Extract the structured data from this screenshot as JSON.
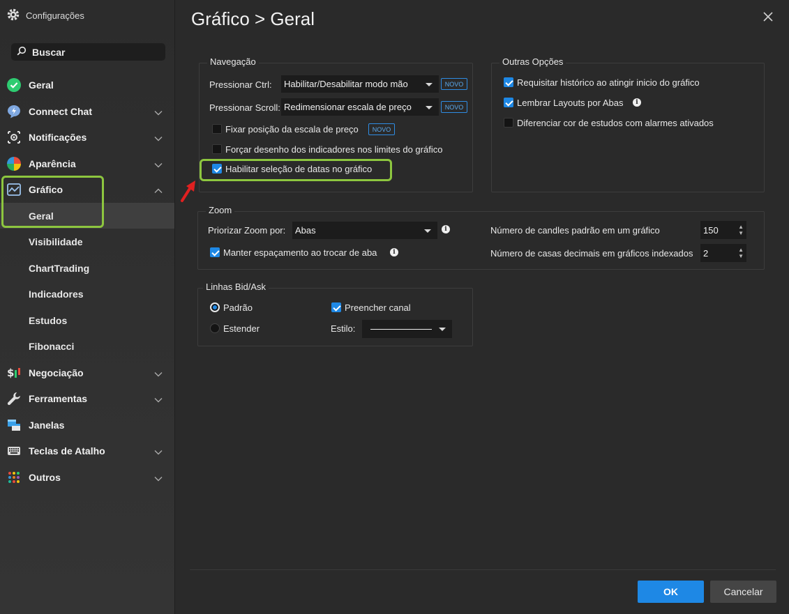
{
  "sidebar": {
    "title": "Configurações",
    "search_label": "Buscar",
    "items": [
      {
        "label": "Geral"
      },
      {
        "label": "Connect Chat"
      },
      {
        "label": "Notificações"
      },
      {
        "label": "Aparência"
      },
      {
        "label": "Gráfico"
      },
      {
        "label": "Negociação"
      },
      {
        "label": "Ferramentas"
      },
      {
        "label": "Janelas"
      },
      {
        "label": "Teclas de Atalho"
      },
      {
        "label": "Outros"
      }
    ],
    "sub_items": [
      {
        "label": "Geral"
      },
      {
        "label": "Visibilidade"
      },
      {
        "label": "ChartTrading"
      },
      {
        "label": "Indicadores"
      },
      {
        "label": "Estudos"
      },
      {
        "label": "Fibonacci"
      }
    ]
  },
  "main": {
    "title": "Gráfico > Geral",
    "navegacao": {
      "title": "Navegação",
      "ctrl_label": "Pressionar Ctrl:",
      "ctrl_value": "Habilitar/Desabilitar modo mão",
      "scroll_label": "Pressionar Scroll:",
      "scroll_value": "Redimensionar escala de preço",
      "novo": "NOVO",
      "fixar": "Fixar posição da escala de preço",
      "forcar": "Forçar desenho dos indicadores nos limites do gráfico",
      "habilitar": "Habilitar seleção de datas no gráfico"
    },
    "outras": {
      "title": "Outras Opções",
      "opt1": "Requisitar histórico ao atingir inicio do gráfico",
      "opt2": "Lembrar Layouts por Abas",
      "opt3": "Diferenciar cor de estudos com alarmes ativados"
    },
    "zoom": {
      "title": "Zoom",
      "priorizar_label": "Priorizar Zoom por:",
      "priorizar_value": "Abas",
      "manter": "Manter espaçamento ao trocar de aba",
      "candles_label": "Número de candles padrão em um gráfico",
      "candles_value": "150",
      "decimais_label": "Número de casas decimais em gráficos indexados",
      "decimais_value": "2"
    },
    "bidask": {
      "title": "Linhas Bid/Ask",
      "padrao": "Padrão",
      "estender": "Estender",
      "preencher": "Preencher canal",
      "estilo_label": "Estilo:"
    }
  },
  "footer": {
    "ok": "OK",
    "cancel": "Cancelar"
  },
  "colors": {
    "accent": "#1e88e5",
    "highlight": "#8dc63f",
    "annotation_arrow": "#e02020"
  }
}
